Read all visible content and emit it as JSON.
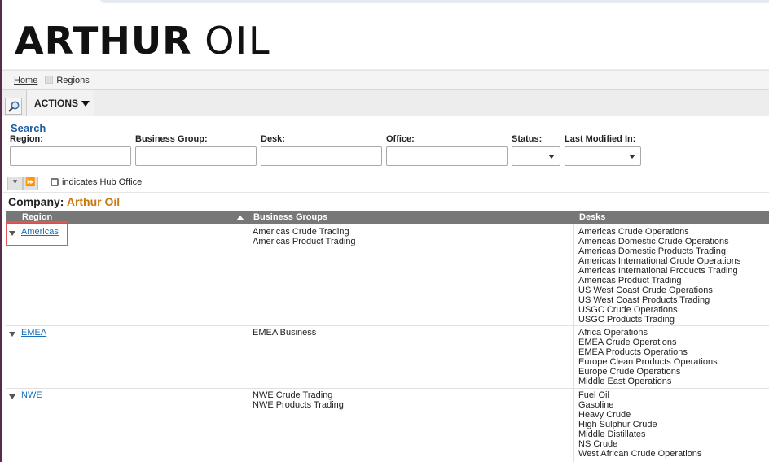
{
  "brand": {
    "logo_bold": "ARTHUR",
    "logo_light": "OIL"
  },
  "breadcrumb": {
    "home": "Home",
    "current": "Regions"
  },
  "toolbar": {
    "actions_label": "ACTIONS"
  },
  "search": {
    "title": "Search",
    "fields": {
      "region": "Region:",
      "business_group": "Business Group:",
      "desk": "Desk:",
      "office": "Office:",
      "status": "Status:",
      "last_modified": "Last Modified In:"
    }
  },
  "hub_note": "indicates Hub Office",
  "company": {
    "label": "Company:",
    "name": "Arthur Oil"
  },
  "table": {
    "headers": {
      "region": "Region",
      "business_groups": "Business Groups",
      "desks": "Desks"
    },
    "rows": [
      {
        "region": "Americas",
        "groups": [
          "Americas Crude Trading",
          "Americas Product Trading"
        ],
        "desks": [
          "Americas Crude Operations",
          "Americas Domestic Crude Operations",
          "Americas Domestic Products Trading",
          "Americas International Crude Operations",
          "Americas International Products Trading",
          "Americas Product Trading",
          "US West Coast Crude Operations",
          "US West Coast Products Trading",
          "USGC Crude Operations",
          "USGC Products Trading"
        ]
      },
      {
        "region": "EMEA",
        "groups": [
          "EMEA Business"
        ],
        "desks": [
          "Africa Operations",
          "EMEA Crude Operations",
          "EMEA Products Operations",
          "Europe Clean Products Operations",
          "Europe Crude Operations",
          "Middle East Operations"
        ]
      },
      {
        "region": "NWE",
        "groups": [
          "NWE Crude Trading",
          "NWE Products Trading"
        ],
        "desks": [
          "Fuel Oil",
          "Gasoline",
          "Heavy Crude",
          "High Sulphur Crude",
          "Middle Distillates",
          "NS Crude",
          "West African Crude Operations"
        ]
      }
    ]
  },
  "colors": {
    "link": "#1a6fb8",
    "company_link": "#c77a12",
    "header_bg": "#777777",
    "highlight": "#e05555"
  }
}
